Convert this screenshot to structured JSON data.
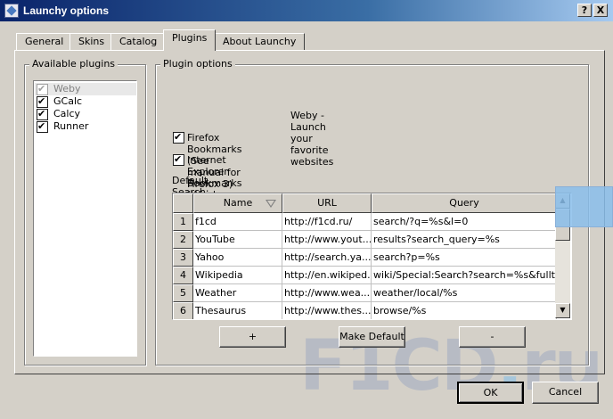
{
  "window": {
    "title": "Launchy options",
    "help_button": "?",
    "close_button": "X"
  },
  "tabs": [
    {
      "label": "General",
      "active": false
    },
    {
      "label": "Skins",
      "active": false
    },
    {
      "label": "Catalog",
      "active": false
    },
    {
      "label": "Plugins",
      "active": true
    },
    {
      "label": "About Launchy",
      "active": false
    }
  ],
  "available_plugins": {
    "title": "Available plugins",
    "items": [
      {
        "label": "Weby",
        "checked": true,
        "selected": true
      },
      {
        "label": "GCalc",
        "checked": true,
        "selected": false
      },
      {
        "label": "Calcy",
        "checked": true,
        "selected": false
      },
      {
        "label": "Runner",
        "checked": true,
        "selected": false
      }
    ]
  },
  "plugin_options": {
    "title": "Plugin options",
    "description": "Weby - Launch your favorite websites",
    "firefox_bookmarks": {
      "label": "Firefox Bookmarks (See manual for Firefox 3)",
      "checked": true
    },
    "ie_bookmarks": {
      "label": "Internet Explorer Bookmarks (Windows only)",
      "checked": true
    },
    "default_search_label": "Default Search:",
    "table": {
      "columns": [
        "Name",
        "URL",
        "Query"
      ],
      "rows": [
        {
          "num": "1",
          "name": "f1cd",
          "url": "http://f1cd.ru/",
          "query": "search/?q=%s&l=0"
        },
        {
          "num": "2",
          "name": "YouTube",
          "url": "http://www.yout...",
          "query": "results?search_query=%s"
        },
        {
          "num": "3",
          "name": "Yahoo",
          "url": "http://search.ya...",
          "query": "search?p=%s"
        },
        {
          "num": "4",
          "name": "Wikipedia",
          "url": "http://en.wikiped...",
          "query": "wiki/Special:Search?search=%s&fulltex..."
        },
        {
          "num": "5",
          "name": "Weather",
          "url": "http://www.wea...",
          "query": "weather/local/%s"
        },
        {
          "num": "6",
          "name": "Thesaurus",
          "url": "http://www.thes...",
          "query": "browse/%s"
        }
      ]
    },
    "add_button": "+",
    "make_default_button": "Make Default",
    "remove_button": "-"
  },
  "footer": {
    "ok_button": "OK",
    "cancel_button": "Cancel"
  },
  "watermark": {
    "part1": "F1CD",
    "dot": ".",
    "part2": "ru"
  }
}
